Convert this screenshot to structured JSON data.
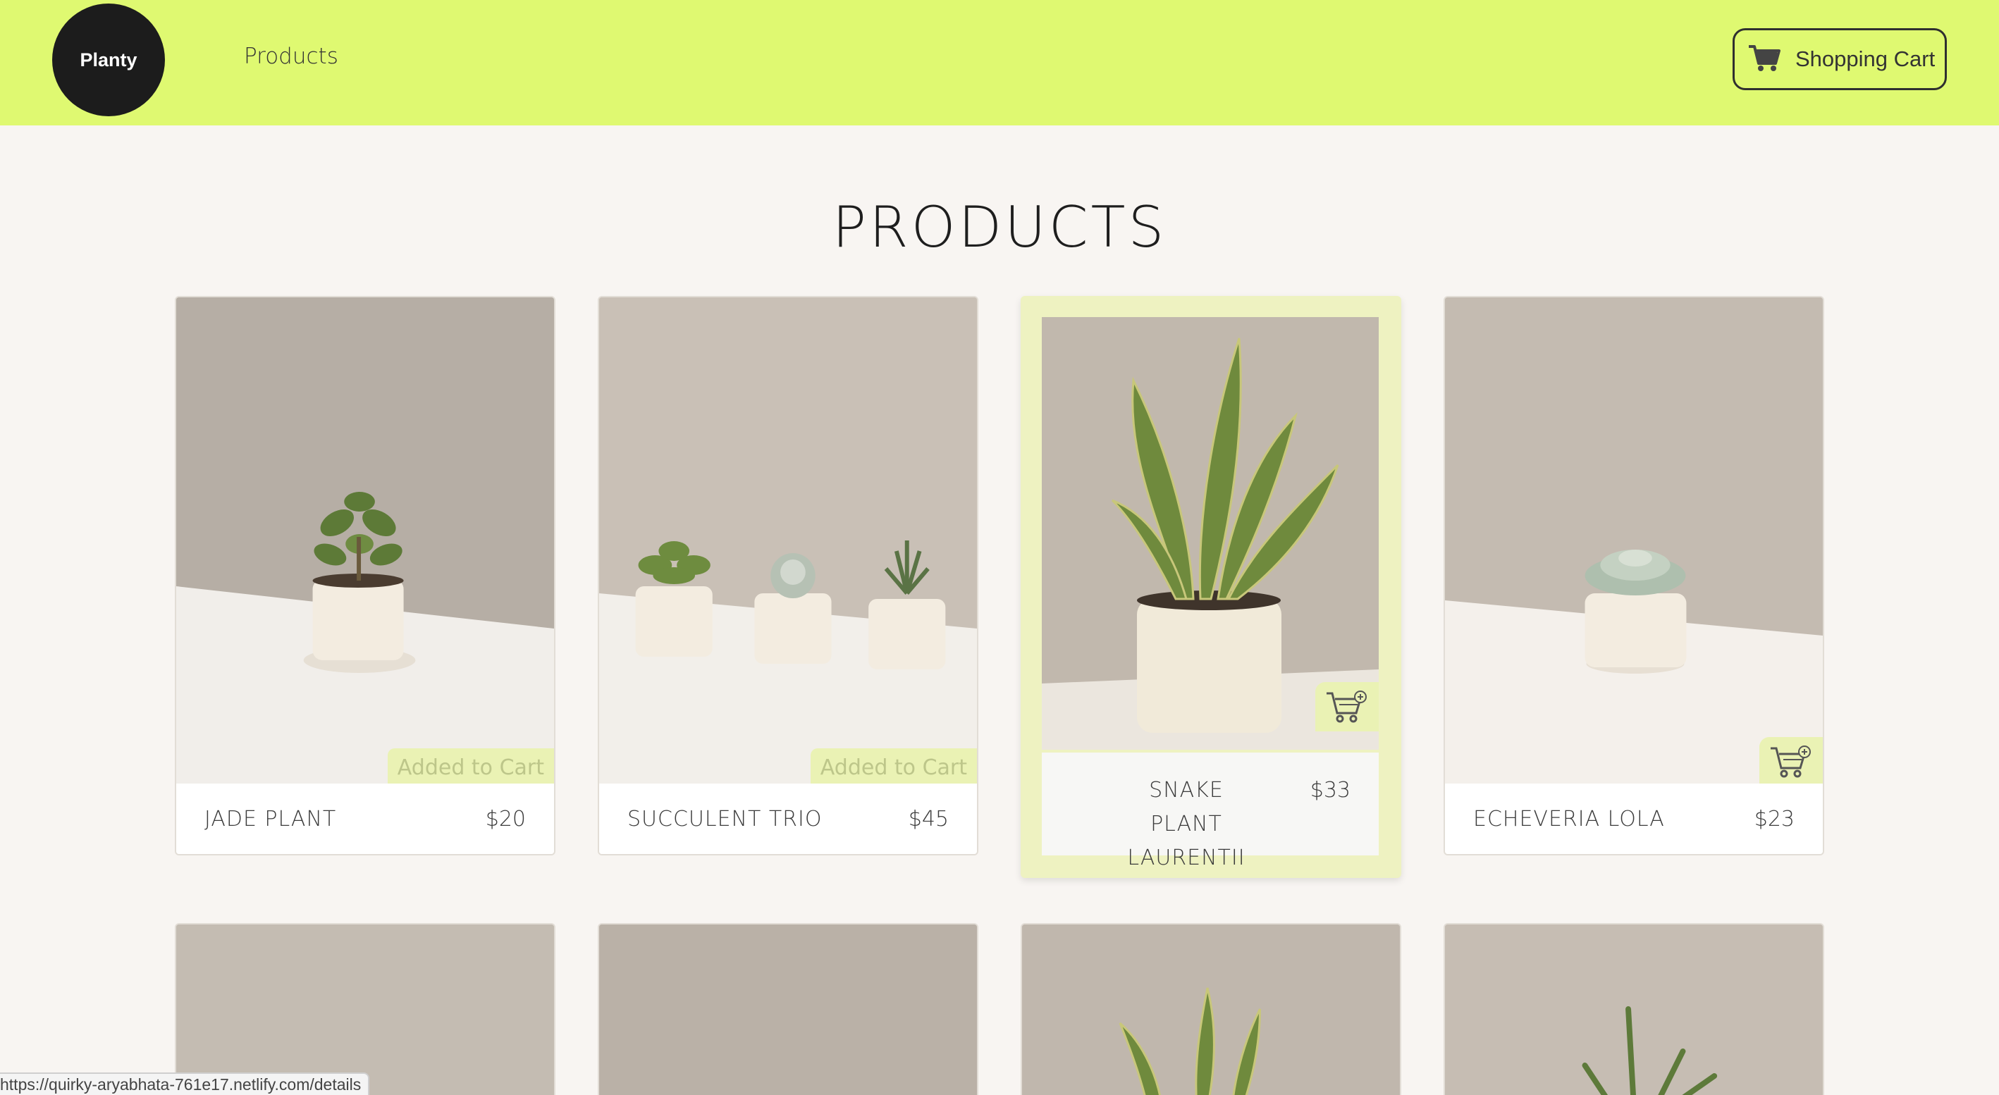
{
  "header": {
    "logo_text": "Planty",
    "nav_products": "Products",
    "cart_label": "Shopping Cart",
    "background_color": "#dff971",
    "cart_icon": "shopping-cart-icon"
  },
  "main": {
    "title": "PRODUCTS",
    "products": [
      {
        "name": "JADE PLANT",
        "price": "$20",
        "status": "Added to Cart"
      },
      {
        "name": "SUCCULENT TRIO",
        "price": "$45",
        "status": "Added to Cart"
      },
      {
        "name": "SNAKE PLANT LAURENTII",
        "price": "$33",
        "status": "add-to-cart"
      },
      {
        "name": "ECHEVERIA LOLA",
        "price": "$23",
        "status": "add-to-cart"
      }
    ]
  },
  "status_bar": {
    "url": "https://quirky-aryabhata-761e17.netlify.com/details"
  }
}
